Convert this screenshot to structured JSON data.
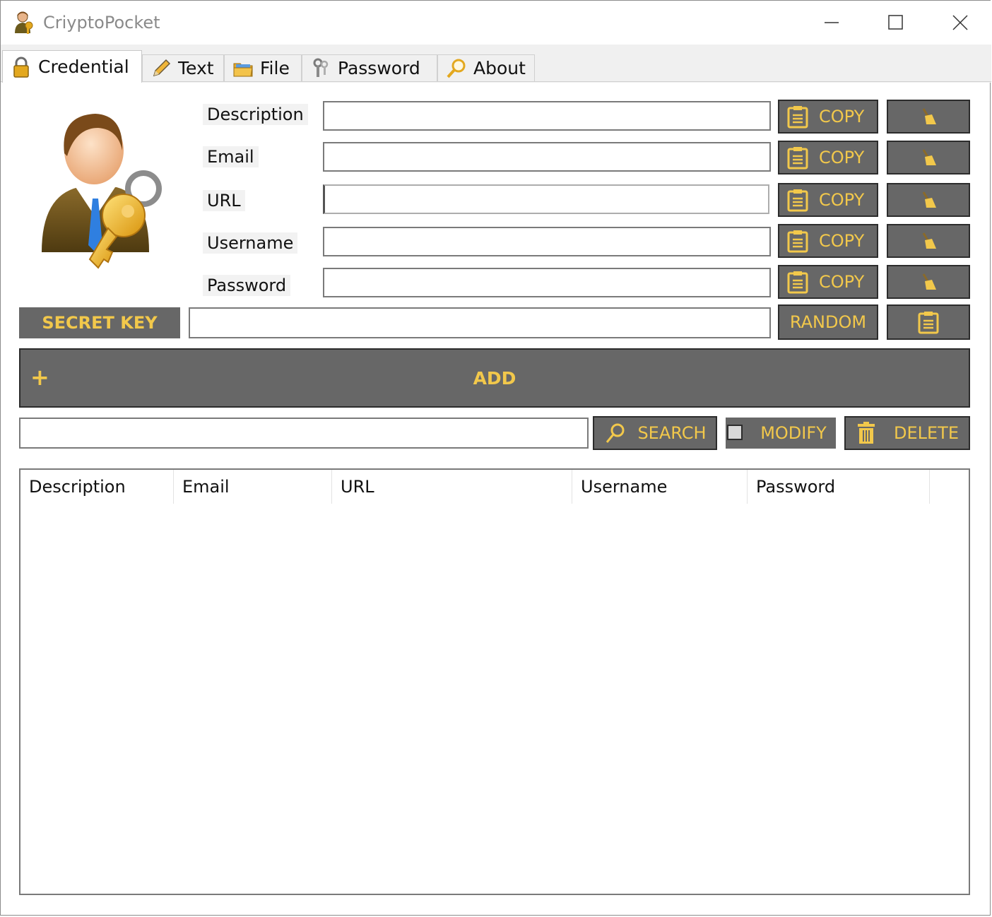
{
  "window": {
    "title": "CriyptoPocket",
    "controls": [
      "minimize",
      "maximize",
      "close"
    ]
  },
  "tabs": [
    {
      "label": "Credential",
      "icon": "lock-icon",
      "active": true
    },
    {
      "label": "Text",
      "icon": "pencil-icon",
      "active": false
    },
    {
      "label": "File",
      "icon": "folder-icon",
      "active": false
    },
    {
      "label": "Password",
      "icon": "keys-icon",
      "active": false
    },
    {
      "label": "About",
      "icon": "magnifier-icon",
      "active": false
    }
  ],
  "form": {
    "fields": [
      {
        "label": "Description",
        "value": "",
        "copy_label": "COPY"
      },
      {
        "label": "Email",
        "value": "",
        "copy_label": "COPY"
      },
      {
        "label": "URL",
        "value": "",
        "copy_label": "COPY"
      },
      {
        "label": "Username",
        "value": "",
        "copy_label": "COPY"
      },
      {
        "label": "Password",
        "value": "",
        "copy_label": "COPY"
      }
    ],
    "secret_key_label": "SECRET KEY",
    "secret_key_value": "",
    "random_label": "RANDOM"
  },
  "actions": {
    "add_label": "ADD",
    "add_icon": "+",
    "search_value": "",
    "search_label": "SEARCH",
    "modify_label": "MODIFY",
    "modify_checked": false,
    "delete_label": "DELETE"
  },
  "table": {
    "columns": [
      "Description",
      "Email",
      "URL",
      "Username",
      "Password"
    ],
    "rows": []
  },
  "colors": {
    "button_bg": "#676767",
    "accent_text": "#f2c84b",
    "tab_bg": "#f0f0f0"
  }
}
